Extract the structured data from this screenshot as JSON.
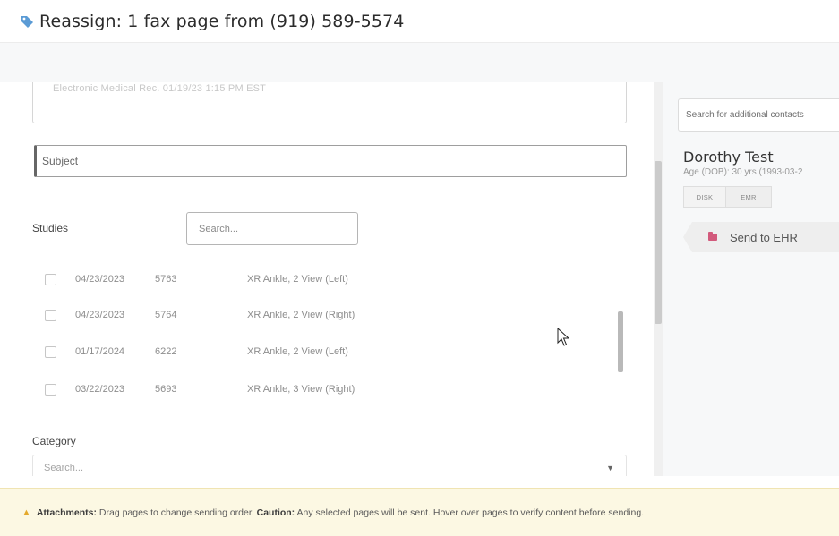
{
  "header": {
    "title": "Reassign: 1 fax page from (919) 589-5574",
    "icon": "tag-icon",
    "icon_color": "#5b9bd5"
  },
  "left": {
    "top_box_faded_text": "Electronic Medical Rec. 01/19/23 1:15 PM EST",
    "subject_placeholder": "Subject",
    "studies_label": "Studies",
    "studies_search_placeholder": "Search...",
    "studies": [
      {
        "date": "04/23/2023",
        "number": "5763",
        "desc": "XR Ankle, 2 View (Left)"
      },
      {
        "date": "04/23/2023",
        "number": "5764",
        "desc": "XR Ankle, 2 View (Right)"
      },
      {
        "date": "01/17/2024",
        "number": "6222",
        "desc": "XR Ankle, 2 View (Left)"
      },
      {
        "date": "03/22/2023",
        "number": "5693",
        "desc": "XR Ankle, 3 View (Right)"
      }
    ],
    "category_label": "Category",
    "category_placeholder": "Search...",
    "category_caret": "▼"
  },
  "right": {
    "contact_search_placeholder": "Search for additional contacts",
    "contact": {
      "name": "Dorothy Test",
      "age": "Age (DOB): 30 yrs (1993-03-2",
      "tabs": [
        "DISK",
        "EMR"
      ],
      "send_button": "Send to EHR",
      "send_icon": "folder-icon",
      "send_icon_color": "#d25a7c"
    }
  },
  "footer": {
    "icon": "warning-icon",
    "icon_color": "#e4a92c",
    "attachments_label": "Attachments:",
    "attachments_text": " Drag pages to change sending order. ",
    "caution_label": "Caution:",
    "caution_text": " Any selected pages will be sent. Hover over pages to verify content before sending."
  }
}
